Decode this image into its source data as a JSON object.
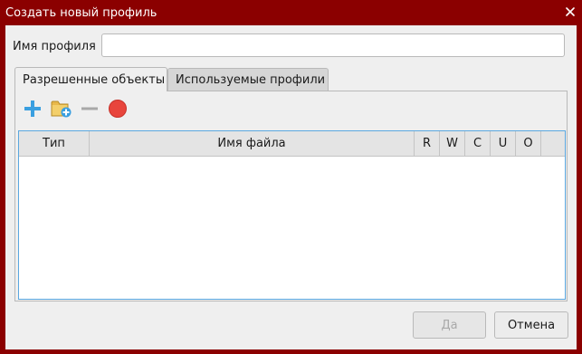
{
  "window": {
    "title": "Создать новый профиль",
    "title_bar_color": "#8b0000"
  },
  "form": {
    "profile_name_label": "Имя профиля",
    "profile_name_value": ""
  },
  "tabs": [
    {
      "label": "Разрешенные объекты",
      "active": true
    },
    {
      "label": "Используемые профили",
      "active": false
    }
  ],
  "toolbar": {
    "add_icon": "plus-icon",
    "add_folder_icon": "folder-add-icon",
    "remove_icon": "minus-icon",
    "record_icon": "record-icon"
  },
  "table": {
    "columns": [
      "Тип",
      "Имя файла",
      "R",
      "W",
      "C",
      "U",
      "O"
    ],
    "rows": []
  },
  "buttons": {
    "ok_label": "Да",
    "ok_enabled": false,
    "cancel_label": "Отмена"
  },
  "colors": {
    "accent": "#3a9fe0",
    "table_focus_border": "#5aa7e0",
    "record": "#e8453c"
  }
}
